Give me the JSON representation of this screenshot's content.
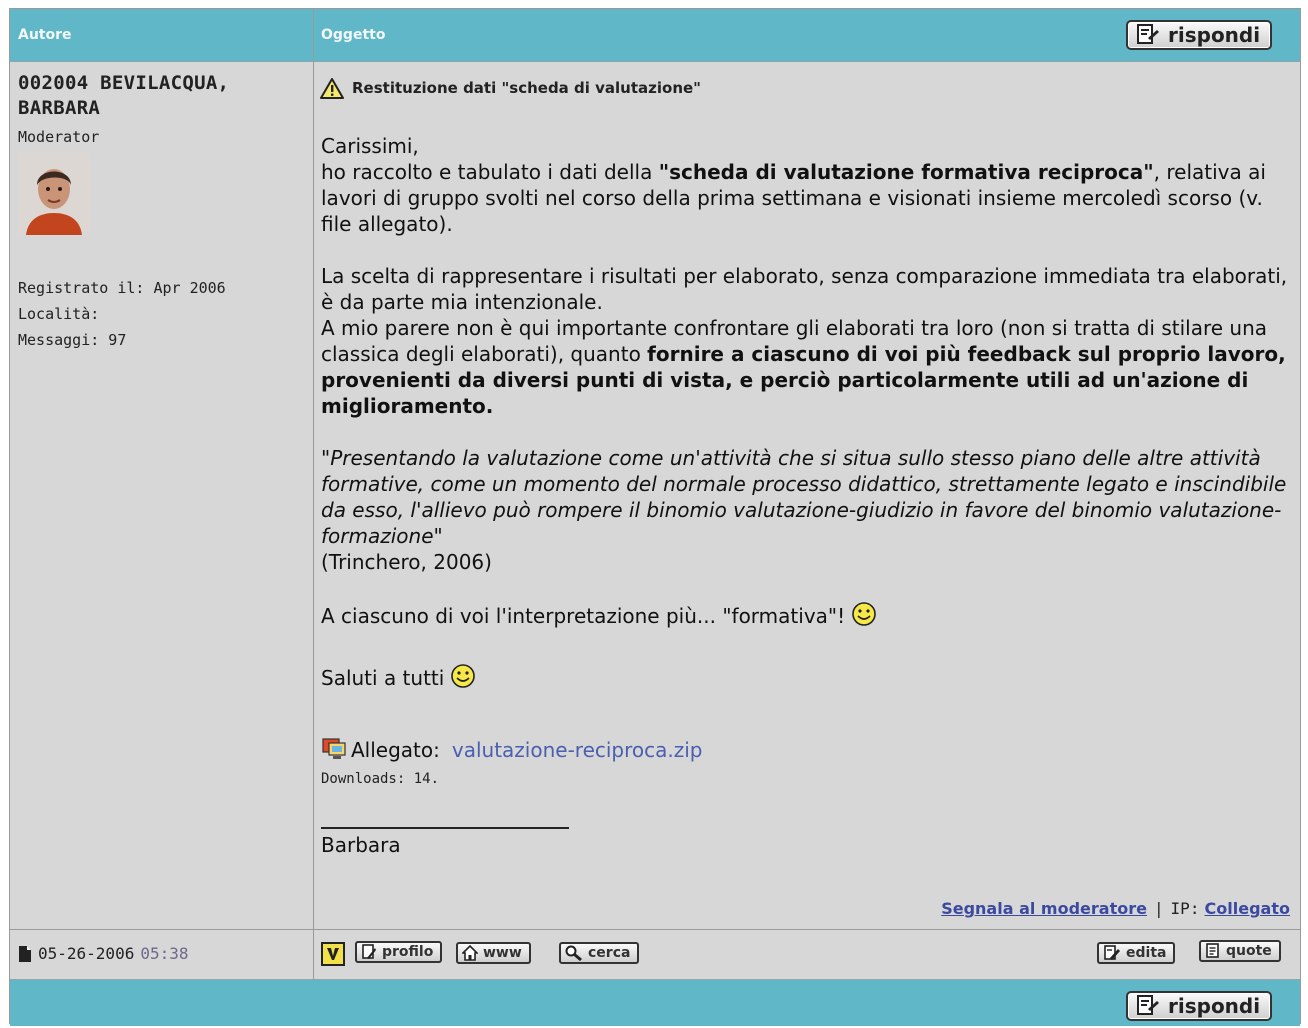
{
  "header": {
    "author_col": "Autore",
    "subject_col": "Oggetto",
    "reply_label": "rispondi"
  },
  "author": {
    "name": "002004 BEVILACQUA, BARBARA",
    "role": "Moderator",
    "registered": "Registrato il: Apr 2006",
    "location": "Località:",
    "messages": "Messaggi: 97"
  },
  "post": {
    "subject": "Restituzione dati \"scheda di valutazione\"",
    "greeting": "Carissimi,",
    "p1_a": "ho raccolto e tabulato i dati della ",
    "p1_bold": "\"scheda di valutazione formativa reciproca\"",
    "p1_b": ", relativa ai lavori di gruppo svolti nel corso della prima settimana e visionati insieme mercoledì scorso (v. file allegato).",
    "p2": "La scelta di rappresentare i risultati per elaborato, senza comparazione immediata tra elaborati, è da parte mia intenzionale.",
    "p3_a": "A mio parere non è qui importante confrontare gli elaborati tra loro (non si tratta di stilare una classica degli elaborati), quanto ",
    "p3_bold": "fornire a ciascuno di voi più feedback sul proprio lavoro, provenienti da diversi punti di vista, e perciò particolarmente utili ad un'azione di miglioramento.",
    "quote": "\"Presentando la valutazione come un'attività che si situa sullo stesso piano delle altre attività formative, come un momento del normale processo didattico, strettamente legato e inscindibile da esso, l'allievo può rompere il binomio valutazione-giudizio in favore del binomio valutazione- formazione\"",
    "citation": "(Trinchero, 2006)",
    "line_wish": "A ciascuno di voi l'interpretazione più... \"formativa\"!",
    "line_saluti": "Saluti a tutti",
    "attachment_label": "Allegato:",
    "attachment_file": "valutazione-reciproca.zip",
    "downloads": "Downloads: 14.",
    "signature": "Barbara"
  },
  "controls": {
    "report": "Segnala al moderatore",
    "separator": "|",
    "ip_label": "IP:",
    "ip_value": "Collegato"
  },
  "footer": {
    "date": "05-26-2006",
    "time": "05:38",
    "profile_label": "profilo",
    "www_label": "www",
    "search_label": "cerca",
    "edit_label": "edita",
    "quote_label": "quote"
  },
  "colors": {
    "header_bar": "#5fb7c7",
    "panel": "#d7d7d7",
    "link": "#4a5fb0",
    "time": "#6a6a8a"
  }
}
